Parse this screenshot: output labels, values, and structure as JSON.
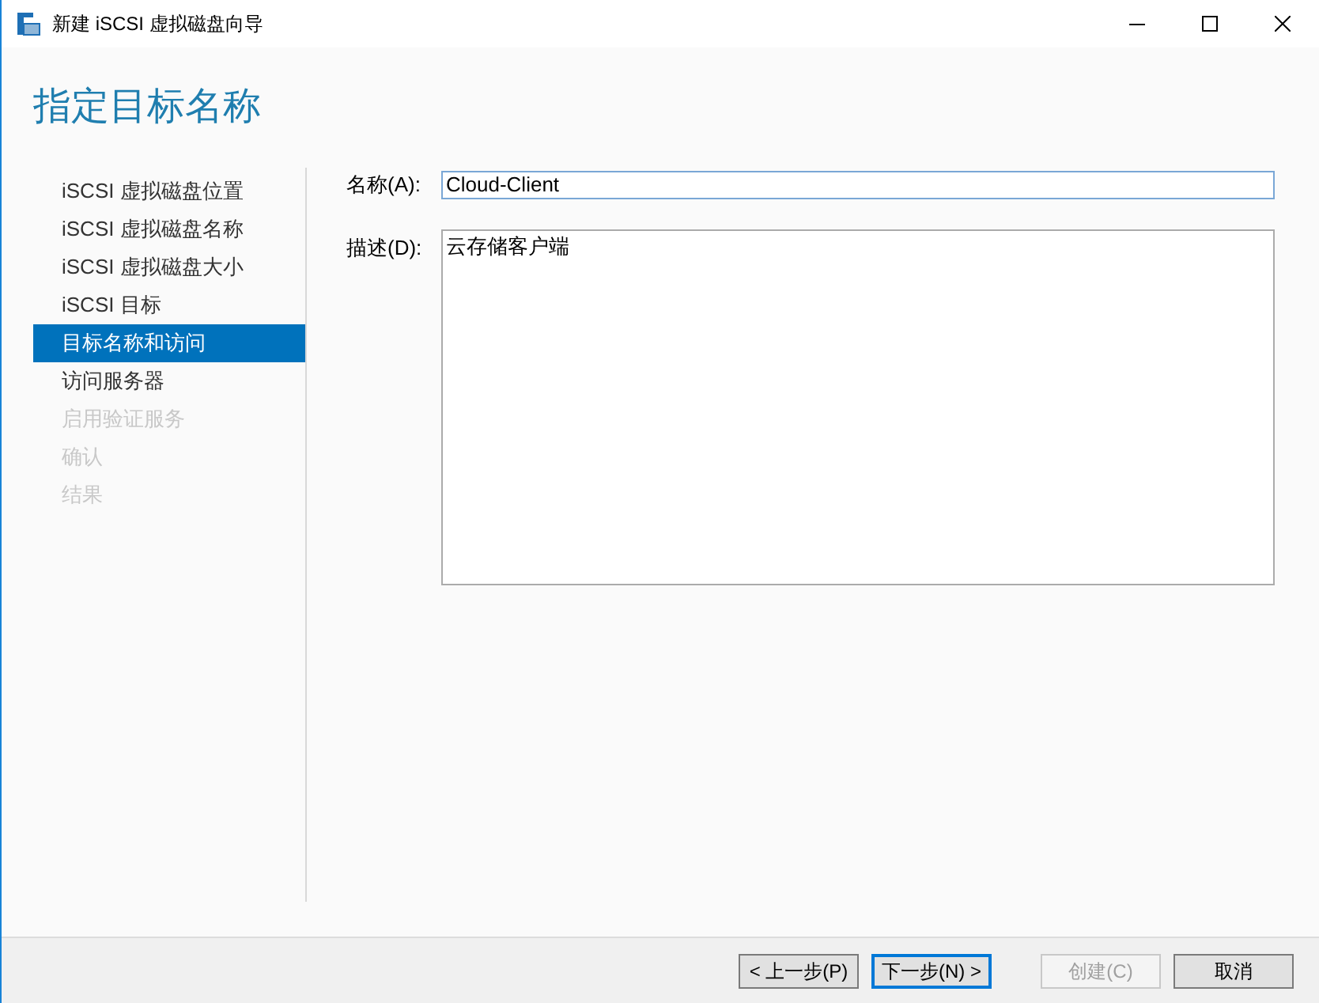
{
  "window": {
    "title": "新建 iSCSI 虚拟磁盘向导"
  },
  "heading": "指定目标名称",
  "steps": [
    {
      "label": "iSCSI 虚拟磁盘位置",
      "selected": false,
      "disabled": false
    },
    {
      "label": "iSCSI 虚拟磁盘名称",
      "selected": false,
      "disabled": false
    },
    {
      "label": "iSCSI 虚拟磁盘大小",
      "selected": false,
      "disabled": false
    },
    {
      "label": "iSCSI 目标",
      "selected": false,
      "disabled": false
    },
    {
      "label": "目标名称和访问",
      "selected": true,
      "disabled": false
    },
    {
      "label": "访问服务器",
      "selected": false,
      "disabled": false
    },
    {
      "label": "启用验证服务",
      "selected": false,
      "disabled": true
    },
    {
      "label": "确认",
      "selected": false,
      "disabled": true
    },
    {
      "label": "结果",
      "selected": false,
      "disabled": true
    }
  ],
  "name_field": {
    "label": "名称(A):",
    "value": "Cloud-Client"
  },
  "description_field": {
    "label": "描述(D):",
    "value": "云存储客户端"
  },
  "buttons": [
    {
      "label": "< 上一步(P)",
      "disabled": false,
      "default": false
    },
    {
      "label": "下一步(N) >",
      "disabled": false,
      "default": true
    },
    {
      "label": "创建(C)",
      "disabled": true,
      "default": false
    },
    {
      "label": "取消",
      "disabled": false,
      "default": false
    }
  ]
}
